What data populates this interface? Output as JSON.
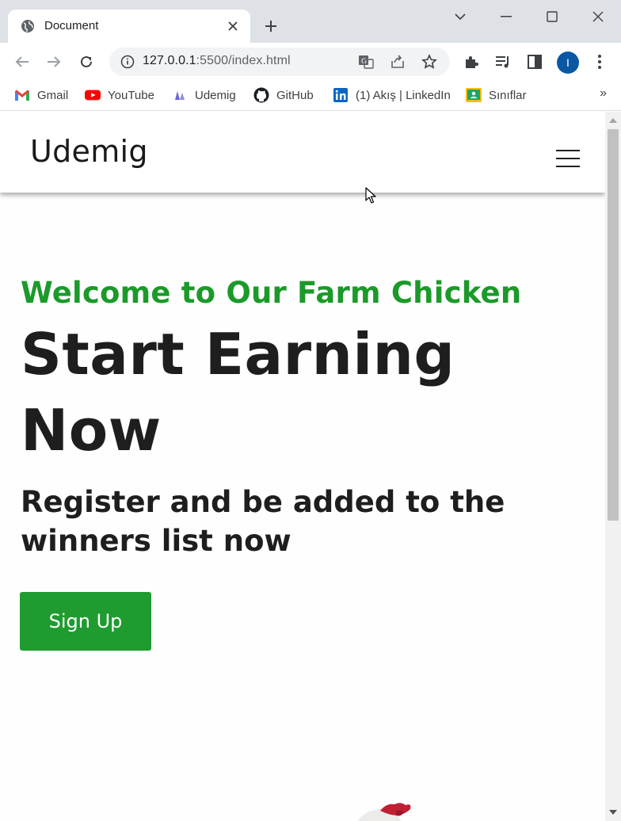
{
  "browser": {
    "tab_title": "Document",
    "url_host": "127.0.0.1",
    "url_rest": ":5500/index.html",
    "profile_initial": "I",
    "bookmarks": [
      {
        "label": "Gmail",
        "icon": "gmail-icon"
      },
      {
        "label": "YouTube",
        "icon": "youtube-icon"
      },
      {
        "label": "Udemig",
        "icon": "udemig-icon"
      },
      {
        "label": "GitHub",
        "icon": "github-icon"
      },
      {
        "label": "(1) Akış | LinkedIn",
        "icon": "linkedin-icon"
      },
      {
        "label": "Sınıflar",
        "icon": "classroom-icon"
      }
    ],
    "bookmarks_more": "»"
  },
  "site": {
    "brand": "Udemig",
    "kicker": "Welcome to Our Farm Chicken",
    "headline": "Start Earning Now",
    "subhead": "Register and be added to the winners list now",
    "cta_label": "Sign Up"
  },
  "colors": {
    "accent_green": "#1b9a2a",
    "button_green": "#1f9b30",
    "avatar_blue": "#0b57a4"
  }
}
